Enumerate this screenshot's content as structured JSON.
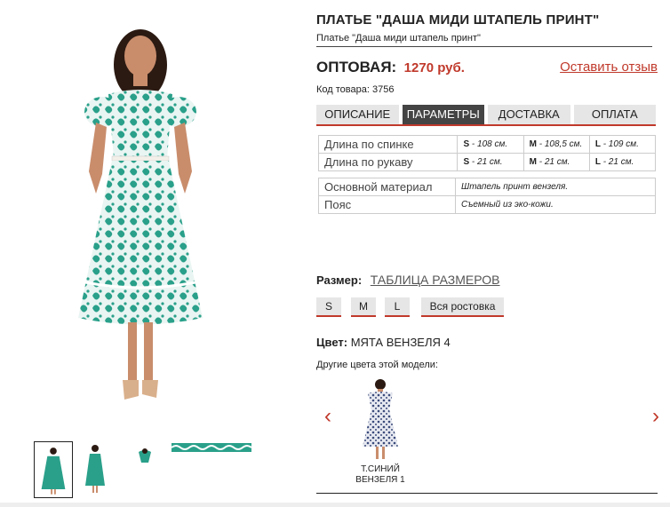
{
  "product": {
    "title": "ПЛАТЬЕ \"ДАША МИДИ ШТАПЕЛЬ ПРИНТ\"",
    "subtitle": "Платье \"Даша миди штапель принт\"",
    "price_label": "ОПТОВАЯ:",
    "price_value": "1270 руб.",
    "review_link": "Оставить отзыв",
    "sku": "Код товара: 3756"
  },
  "tabs": [
    "ОПИСАНИЕ",
    "ПАРАМЕТРЫ",
    "ДОСТАВКА",
    "ОПЛАТА"
  ],
  "active_tab": "ПАРАМЕТРЫ",
  "measurements": [
    {
      "label": "Длина по спинке",
      "s": "- 108 см.",
      "m": "- 108,5 см.",
      "l": "- 109 см."
    },
    {
      "label": "Длина по рукаву",
      "s": "- 21 см.",
      "m": "- 21 см.",
      "l": "- 21 см."
    }
  ],
  "size_letters": {
    "s": "S",
    "m": "M",
    "l": "L"
  },
  "properties": [
    {
      "label": "Основной материал",
      "value": "Штапель принт вензеля."
    },
    {
      "label": "Пояс",
      "value": "Съемный из эко-кожи."
    }
  ],
  "size_section": {
    "label": "Размер:",
    "table_link": "ТАБЛИЦА РАЗМЕРОВ",
    "options": [
      "S",
      "M",
      "L",
      "Вся ростовка"
    ]
  },
  "color_section": {
    "label": "Цвет:",
    "value": "МЯТА ВЕНЗЕЛЯ 4",
    "other_label": "Другие цвета этой модели:"
  },
  "variants": [
    {
      "line1": "Т.СИНИЙ",
      "line2": "ВЕНЗЕЛЯ 1"
    }
  ],
  "colors": {
    "accent": "#c0392b",
    "dress_main": "#2aa08a",
    "dress_variant": "#3a4a7a"
  }
}
